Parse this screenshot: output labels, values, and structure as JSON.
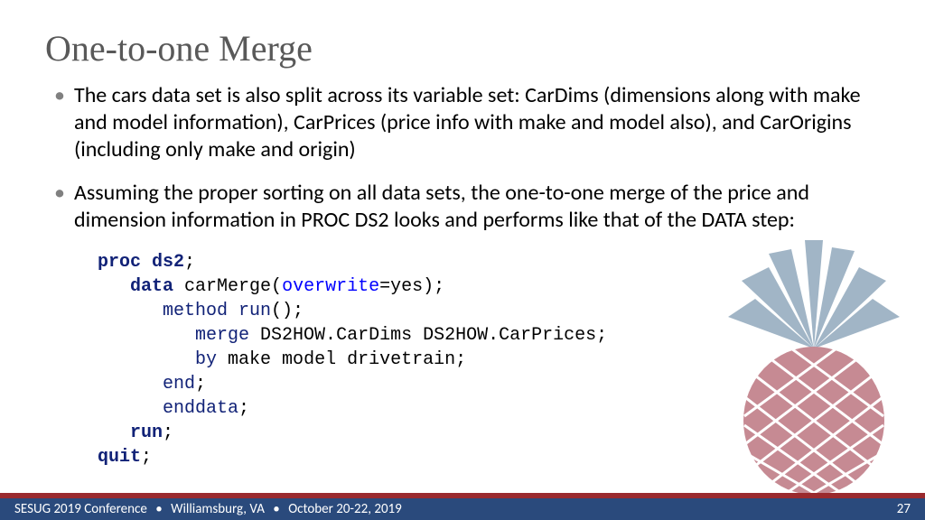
{
  "title": "One-to-one Merge",
  "bullets": [
    "The cars data set is also split across its variable set: CarDims (dimensions along with make and model information), CarPrices (price info with make and model also), and CarOrigins (including only make and origin)",
    "Assuming the proper sorting on all data sets, the one-to-one merge of the price and dimension information in PROC DS2 looks and performs like that of the DATA step:"
  ],
  "code": {
    "l1a": "proc ds2",
    "l1b": ";",
    "l2a": "data",
    "l2b": " carMerge(",
    "l2c": "overwrite",
    "l2d": "=yes);",
    "l3a": "method run",
    "l3b": "();",
    "l4a": "merge",
    "l4b": " DS2HOW.CarDims DS2HOW.CarPrices;",
    "l5a": "by",
    "l5b": " make model drivetrain;",
    "l6a": "end",
    "l6b": ";",
    "l7a": "enddata",
    "l7b": ";",
    "l8a": "run",
    "l8b": ";",
    "l9a": "quit",
    "l9b": ";"
  },
  "footer": {
    "conference": "SESUG 2019 Conference",
    "location": "Williamsburg, VA",
    "dates": "October 20-22, 2019",
    "page": "27"
  },
  "colors": {
    "accent_red": "#9a2a2e",
    "footer_blue": "#2a4a7c",
    "leaf_blue": "#9cb2c4",
    "body_rose": "#c4848e",
    "title_gray": "#595959"
  }
}
